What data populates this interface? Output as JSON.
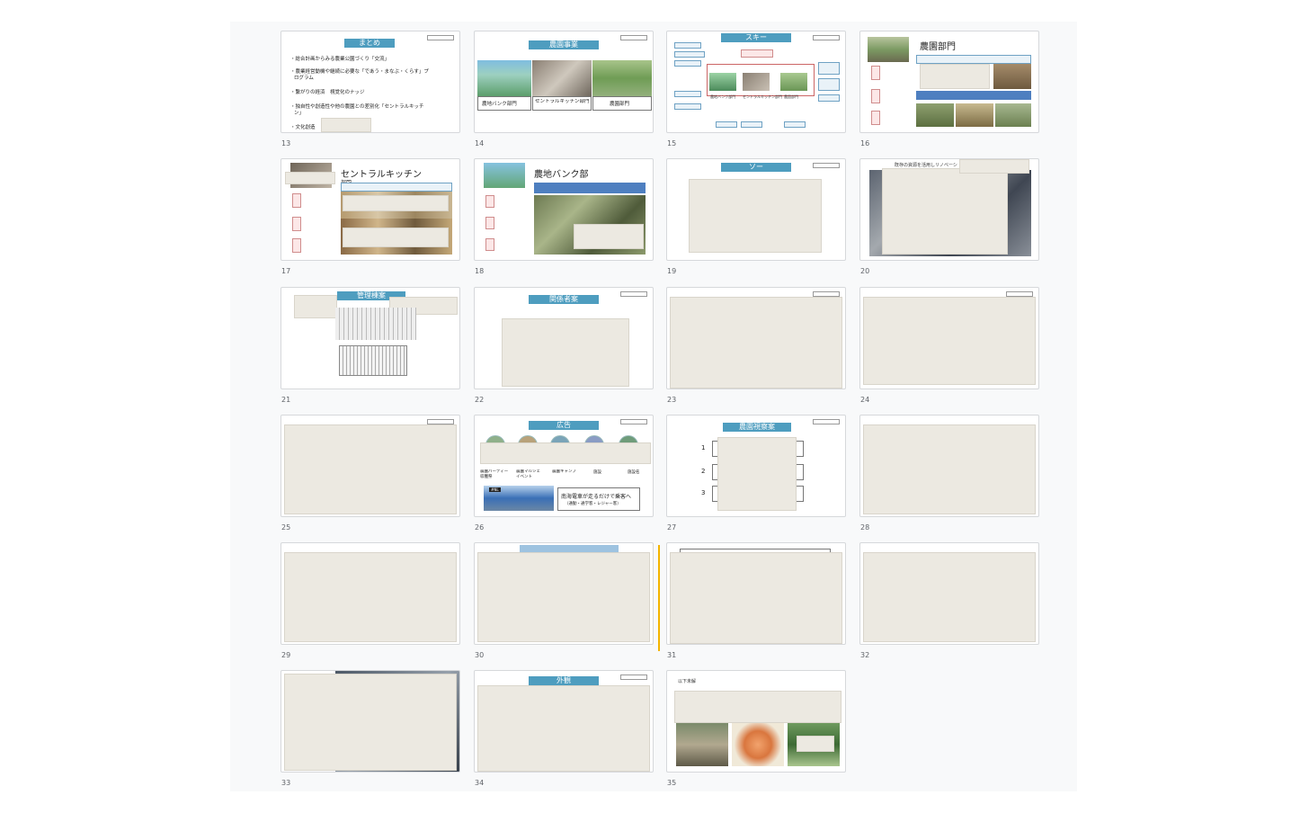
{
  "slides": [
    {
      "num": "13",
      "title": "まとめ",
      "bullets": [
        "・総合計画からみる農業公園づくり「交流」",
        "・農業経営動機や継続に必要な「であう・まなぶ・くらす」プ",
        "ログラム",
        "・繋がりの経済　視覚化のナッジ",
        "・独自性や創造性や他の農園との差別化「セントラルキッチ",
        "ン」",
        "・文化創造"
      ]
    },
    {
      "num": "14",
      "title": "農園事業",
      "captions": [
        "農地バンク部門",
        "セントラルキッチン部門",
        "農園部門"
      ]
    },
    {
      "num": "15",
      "title": "スキー",
      "labels": [
        "セントラルキッチン部門",
        "農地バンク部門",
        "農園部門"
      ]
    },
    {
      "num": "16",
      "title": "農園部門"
    },
    {
      "num": "17",
      "title": "セントラルキッチン",
      "subtitle": "部門"
    },
    {
      "num": "18",
      "title": "農地バンク部"
    },
    {
      "num": "19",
      "title": "ソー"
    },
    {
      "num": "20",
      "title": "既存の資源を活用しリノベーシ"
    },
    {
      "num": "21",
      "title": "管理棟案"
    },
    {
      "num": "22",
      "title": "関係者案"
    },
    {
      "num": "23"
    },
    {
      "num": "24"
    },
    {
      "num": "25"
    },
    {
      "num": "26",
      "title": "広告",
      "captions": [
        "農園パーティー収穫祭",
        "農園マルシェイベント",
        "農園キャンプ",
        "施設",
        "施設名"
      ],
      "banner": "南海電車が走るだけで乗客へ",
      "banner_sub": "（通勤・通学客・レジャー客）",
      "tag": "#NL"
    },
    {
      "num": "27",
      "title": "農園視察案",
      "rows": [
        "1",
        "2",
        "3"
      ]
    },
    {
      "num": "28"
    },
    {
      "num": "29"
    },
    {
      "num": "30"
    },
    {
      "num": "31"
    },
    {
      "num": "32"
    },
    {
      "num": "33"
    },
    {
      "num": "34",
      "title": "外観"
    },
    {
      "num": "35",
      "title": "以下未解"
    }
  ]
}
